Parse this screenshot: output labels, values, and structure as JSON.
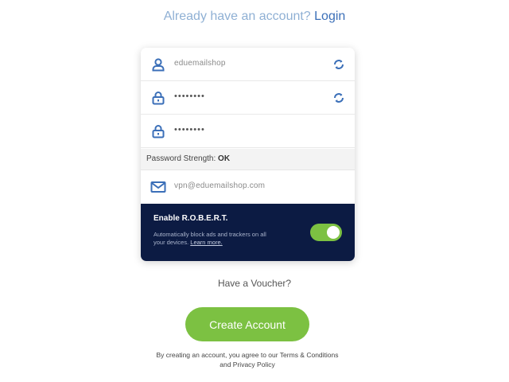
{
  "header": {
    "prefix": "Already have an account?",
    "login_label": "Login"
  },
  "form": {
    "username": {
      "value": "eduemailshop",
      "icon": "user-icon",
      "regen_icon": "refresh-icon"
    },
    "password": {
      "value": "••••••••",
      "icon": "lock-icon",
      "regen_icon": "refresh-icon"
    },
    "confirm_password": {
      "value": "••••••••",
      "icon": "lock-icon"
    },
    "strength": {
      "label": "Password Strength:",
      "value": "OK"
    },
    "email": {
      "placeholder": "vpn@eduemailshop.com",
      "icon": "envelope-icon"
    }
  },
  "robert": {
    "title": "Enable R.O.B.E.R.T.",
    "description": "Automatically block ads and trackers on all your devices.",
    "learn_more": "Learn more.",
    "enabled": true
  },
  "voucher_label": "Have a Voucher?",
  "create_label": "Create Account",
  "terms_text": "By creating an account, you agree to our Terms & Conditions and Privacy Policy",
  "colors": {
    "accent_green": "#7cc142",
    "icon_blue": "#3b6fb8",
    "dark_navy": "#0c1b43",
    "link_light_blue": "#8fb0d4"
  }
}
